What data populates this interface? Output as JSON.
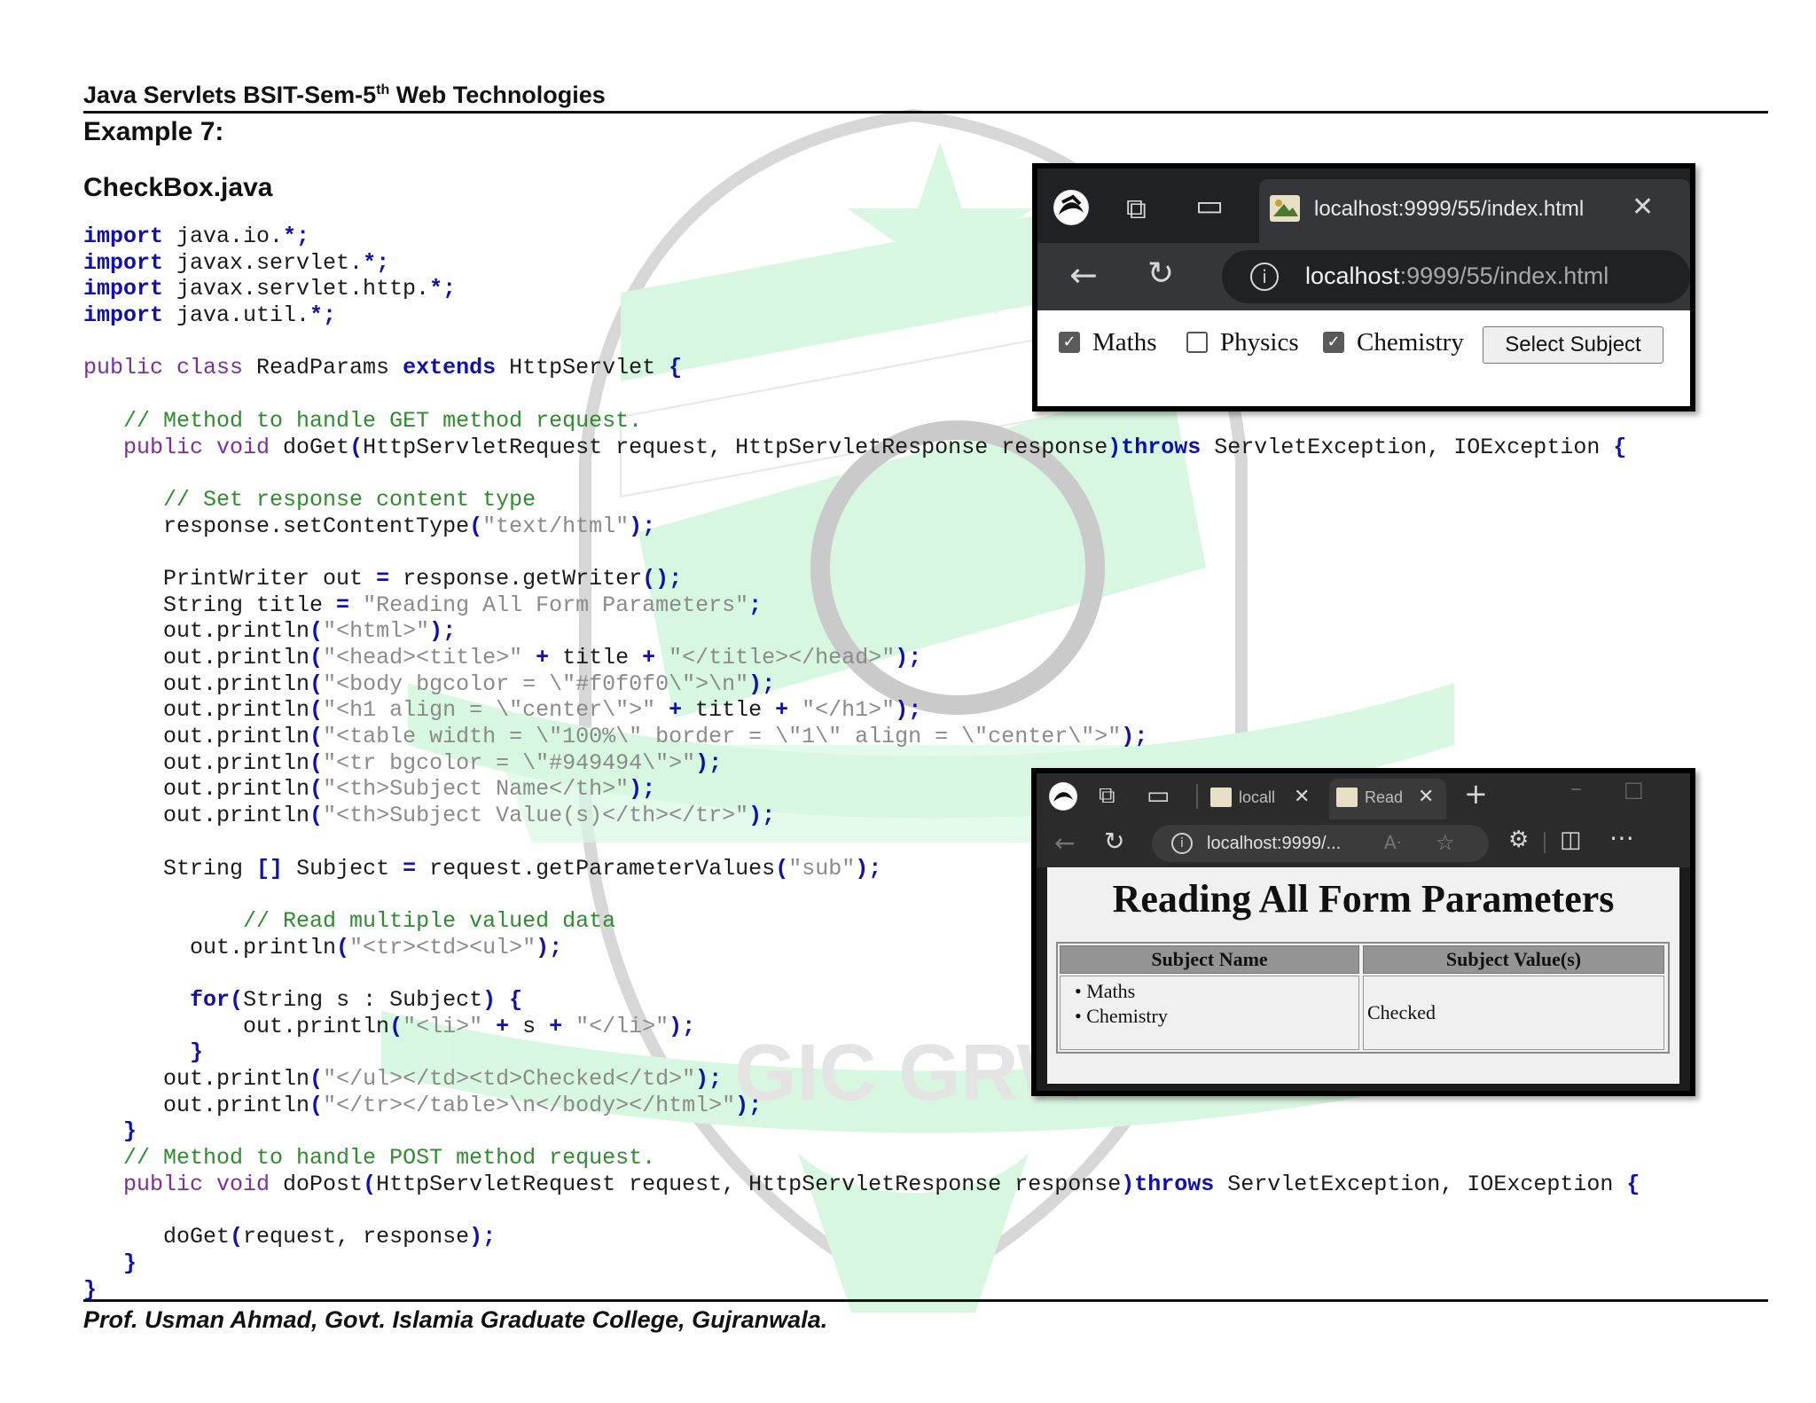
{
  "header": {
    "title_part1": "Java Servlets BSIT-Sem-5",
    "title_sup": "th",
    "title_part2": " Web Technologies"
  },
  "example_title": "Example 7:",
  "file_name": "CheckBox.java",
  "code_lines": [
    [
      {
        "t": "import",
        "c": "kw"
      },
      {
        "t": " java.io."
      },
      {
        "t": "*;",
        "c": "op"
      }
    ],
    [
      {
        "t": "import",
        "c": "kw"
      },
      {
        "t": " javax.servlet."
      },
      {
        "t": "*;",
        "c": "op"
      }
    ],
    [
      {
        "t": "import",
        "c": "kw"
      },
      {
        "t": " javax.servlet.http."
      },
      {
        "t": "*;",
        "c": "op"
      }
    ],
    [
      {
        "t": "import",
        "c": "kw"
      },
      {
        "t": " java.util."
      },
      {
        "t": "*;",
        "c": "op"
      }
    ],
    [],
    [
      {
        "t": "public class",
        "c": "kw2"
      },
      {
        "t": " ReadParams "
      },
      {
        "t": "extends",
        "c": "kw"
      },
      {
        "t": " HttpServlet "
      },
      {
        "t": "{",
        "c": "op"
      }
    ],
    [],
    [
      {
        "t": "   "
      },
      {
        "t": "// Method to handle GET method request.",
        "c": "cm"
      }
    ],
    [
      {
        "t": "   "
      },
      {
        "t": "public void",
        "c": "kw2"
      },
      {
        "t": " doGet"
      },
      {
        "t": "(",
        "c": "op"
      },
      {
        "t": "HttpServletRequest request, HttpServletResponse response"
      },
      {
        "t": ")",
        "c": "op"
      },
      {
        "t": "throws",
        "c": "kw"
      },
      {
        "t": " ServletException, IOException "
      },
      {
        "t": "{",
        "c": "op"
      }
    ],
    [],
    [
      {
        "t": "      "
      },
      {
        "t": "// Set response content type",
        "c": "cm"
      }
    ],
    [
      {
        "t": "      response.setContentType"
      },
      {
        "t": "(",
        "c": "op"
      },
      {
        "t": "\"text/html\"",
        "c": "str"
      },
      {
        "t": ");",
        "c": "op"
      }
    ],
    [],
    [
      {
        "t": "      PrintWriter out "
      },
      {
        "t": "=",
        "c": "op"
      },
      {
        "t": " response.getWriter"
      },
      {
        "t": "();",
        "c": "op"
      }
    ],
    [
      {
        "t": "      String title "
      },
      {
        "t": "=",
        "c": "op"
      },
      {
        "t": " "
      },
      {
        "t": "\"Reading All Form Parameters\"",
        "c": "str"
      },
      {
        "t": ";",
        "c": "op"
      }
    ],
    [
      {
        "t": "      out.println"
      },
      {
        "t": "(",
        "c": "op"
      },
      {
        "t": "\"<html>\"",
        "c": "str"
      },
      {
        "t": ");",
        "c": "op"
      }
    ],
    [
      {
        "t": "      out.println"
      },
      {
        "t": "(",
        "c": "op"
      },
      {
        "t": "\"<head><title>\"",
        "c": "str"
      },
      {
        "t": " + ",
        "c": "op"
      },
      {
        "t": "title"
      },
      {
        "t": " + ",
        "c": "op"
      },
      {
        "t": "\"</title></head>\"",
        "c": "str"
      },
      {
        "t": ");",
        "c": "op"
      }
    ],
    [
      {
        "t": "      out.println"
      },
      {
        "t": "(",
        "c": "op"
      },
      {
        "t": "\"<body bgcolor = \\\"#f0f0f0\\\">\\n\"",
        "c": "str"
      },
      {
        "t": ");",
        "c": "op"
      }
    ],
    [
      {
        "t": "      out.println"
      },
      {
        "t": "(",
        "c": "op"
      },
      {
        "t": "\"<h1 align = \\\"center\\\">\"",
        "c": "str"
      },
      {
        "t": " + ",
        "c": "op"
      },
      {
        "t": "title"
      },
      {
        "t": " + ",
        "c": "op"
      },
      {
        "t": "\"</h1>\"",
        "c": "str"
      },
      {
        "t": ");",
        "c": "op"
      }
    ],
    [
      {
        "t": "      out.println"
      },
      {
        "t": "(",
        "c": "op"
      },
      {
        "t": "\"<table width = \\\"100%\\\" border = \\\"1\\\" align = \\\"center\\\">\"",
        "c": "str"
      },
      {
        "t": ");",
        "c": "op"
      }
    ],
    [
      {
        "t": "      out.println"
      },
      {
        "t": "(",
        "c": "op"
      },
      {
        "t": "\"<tr bgcolor = \\\"#949494\\\">\"",
        "c": "str"
      },
      {
        "t": ");",
        "c": "op"
      }
    ],
    [
      {
        "t": "      out.println"
      },
      {
        "t": "(",
        "c": "op"
      },
      {
        "t": "\"<th>Subject Name</th>\"",
        "c": "str"
      },
      {
        "t": ");",
        "c": "op"
      }
    ],
    [
      {
        "t": "      out.println"
      },
      {
        "t": "(",
        "c": "op"
      },
      {
        "t": "\"<th>Subject Value(s)</th></tr>\"",
        "c": "str"
      },
      {
        "t": ");",
        "c": "op"
      }
    ],
    [],
    [
      {
        "t": "      String "
      },
      {
        "t": "[]",
        "c": "op"
      },
      {
        "t": " Subject "
      },
      {
        "t": "=",
        "c": "op"
      },
      {
        "t": " request.getParameterValues"
      },
      {
        "t": "(",
        "c": "op"
      },
      {
        "t": "\"sub\"",
        "c": "str"
      },
      {
        "t": ");",
        "c": "op"
      }
    ],
    [],
    [
      {
        "t": "            "
      },
      {
        "t": "// Read multiple valued data",
        "c": "cm"
      }
    ],
    [
      {
        "t": "        out.println"
      },
      {
        "t": "(",
        "c": "op"
      },
      {
        "t": "\"<tr><td><ul>\"",
        "c": "str"
      },
      {
        "t": ");",
        "c": "op"
      }
    ],
    [],
    [
      {
        "t": "        "
      },
      {
        "t": "for",
        "c": "kw"
      },
      {
        "t": "(",
        "c": "op"
      },
      {
        "t": "String s : Subject"
      },
      {
        "t": ")",
        "c": "op"
      },
      {
        "t": " "
      },
      {
        "t": "{",
        "c": "op"
      }
    ],
    [
      {
        "t": "            out.println"
      },
      {
        "t": "(",
        "c": "op"
      },
      {
        "t": "\"<li>\"",
        "c": "str"
      },
      {
        "t": " + ",
        "c": "op"
      },
      {
        "t": "s"
      },
      {
        "t": " + ",
        "c": "op"
      },
      {
        "t": "\"</li>\"",
        "c": "str"
      },
      {
        "t": ");",
        "c": "op"
      }
    ],
    [
      {
        "t": "        "
      },
      {
        "t": "}",
        "c": "op"
      }
    ],
    [
      {
        "t": "      out.println"
      },
      {
        "t": "(",
        "c": "op"
      },
      {
        "t": "\"</ul></td><td>Checked</td>\"",
        "c": "str"
      },
      {
        "t": ");",
        "c": "op"
      }
    ],
    [
      {
        "t": "      out.println"
      },
      {
        "t": "(",
        "c": "op"
      },
      {
        "t": "\"</tr></table>\\n</body></html>\"",
        "c": "str"
      },
      {
        "t": ");",
        "c": "op"
      }
    ],
    [
      {
        "t": "   "
      },
      {
        "t": "}",
        "c": "op"
      }
    ],
    [
      {
        "t": "   "
      },
      {
        "t": "// Method to handle POST method request.",
        "c": "cm"
      }
    ],
    [
      {
        "t": "   "
      },
      {
        "t": "public void",
        "c": "kw2"
      },
      {
        "t": " doPost"
      },
      {
        "t": "(",
        "c": "op"
      },
      {
        "t": "HttpServletRequest request, HttpServletResponse response"
      },
      {
        "t": ")",
        "c": "op"
      },
      {
        "t": "throws",
        "c": "kw"
      },
      {
        "t": " ServletException, IOException "
      },
      {
        "t": "{",
        "c": "op"
      }
    ],
    [],
    [
      {
        "t": "      doGet"
      },
      {
        "t": "(",
        "c": "op"
      },
      {
        "t": "request, response"
      },
      {
        "t": ");",
        "c": "op"
      }
    ],
    [
      {
        "t": "   "
      },
      {
        "t": "}",
        "c": "op"
      }
    ],
    [
      {
        "t": "}",
        "c": "op"
      }
    ]
  ],
  "browser1": {
    "tab_title": "localhost:9999/55/index.html",
    "url_host": "localhost",
    "url_rest": ":9999/55/index.html",
    "checkboxes": [
      {
        "label": "Maths",
        "checked": true
      },
      {
        "label": "Physics",
        "checked": false
      },
      {
        "label": "Chemistry",
        "checked": true
      }
    ],
    "submit_label": "Select Subject"
  },
  "browser2": {
    "tab1_title": "locall",
    "tab2_title": "Read",
    "url": "localhost:9999/...",
    "page_title": "Reading All Form Parameters",
    "col1_header": "Subject Name",
    "col2_header": "Subject Value(s)",
    "items": [
      "Maths",
      "Chemistry"
    ],
    "value_text": "Checked"
  },
  "watermark_text": "GIC GRW",
  "footer": "Prof. Usman Ahmad, Govt. Islamia Graduate College, Gujranwala.",
  "colors": {
    "keyword": "#1010b0",
    "keyword_secondary": "#7a2ea0",
    "comment": "#2e8b2e",
    "string": "#8a8a8a",
    "watermark_green": "#b9f2c9"
  }
}
